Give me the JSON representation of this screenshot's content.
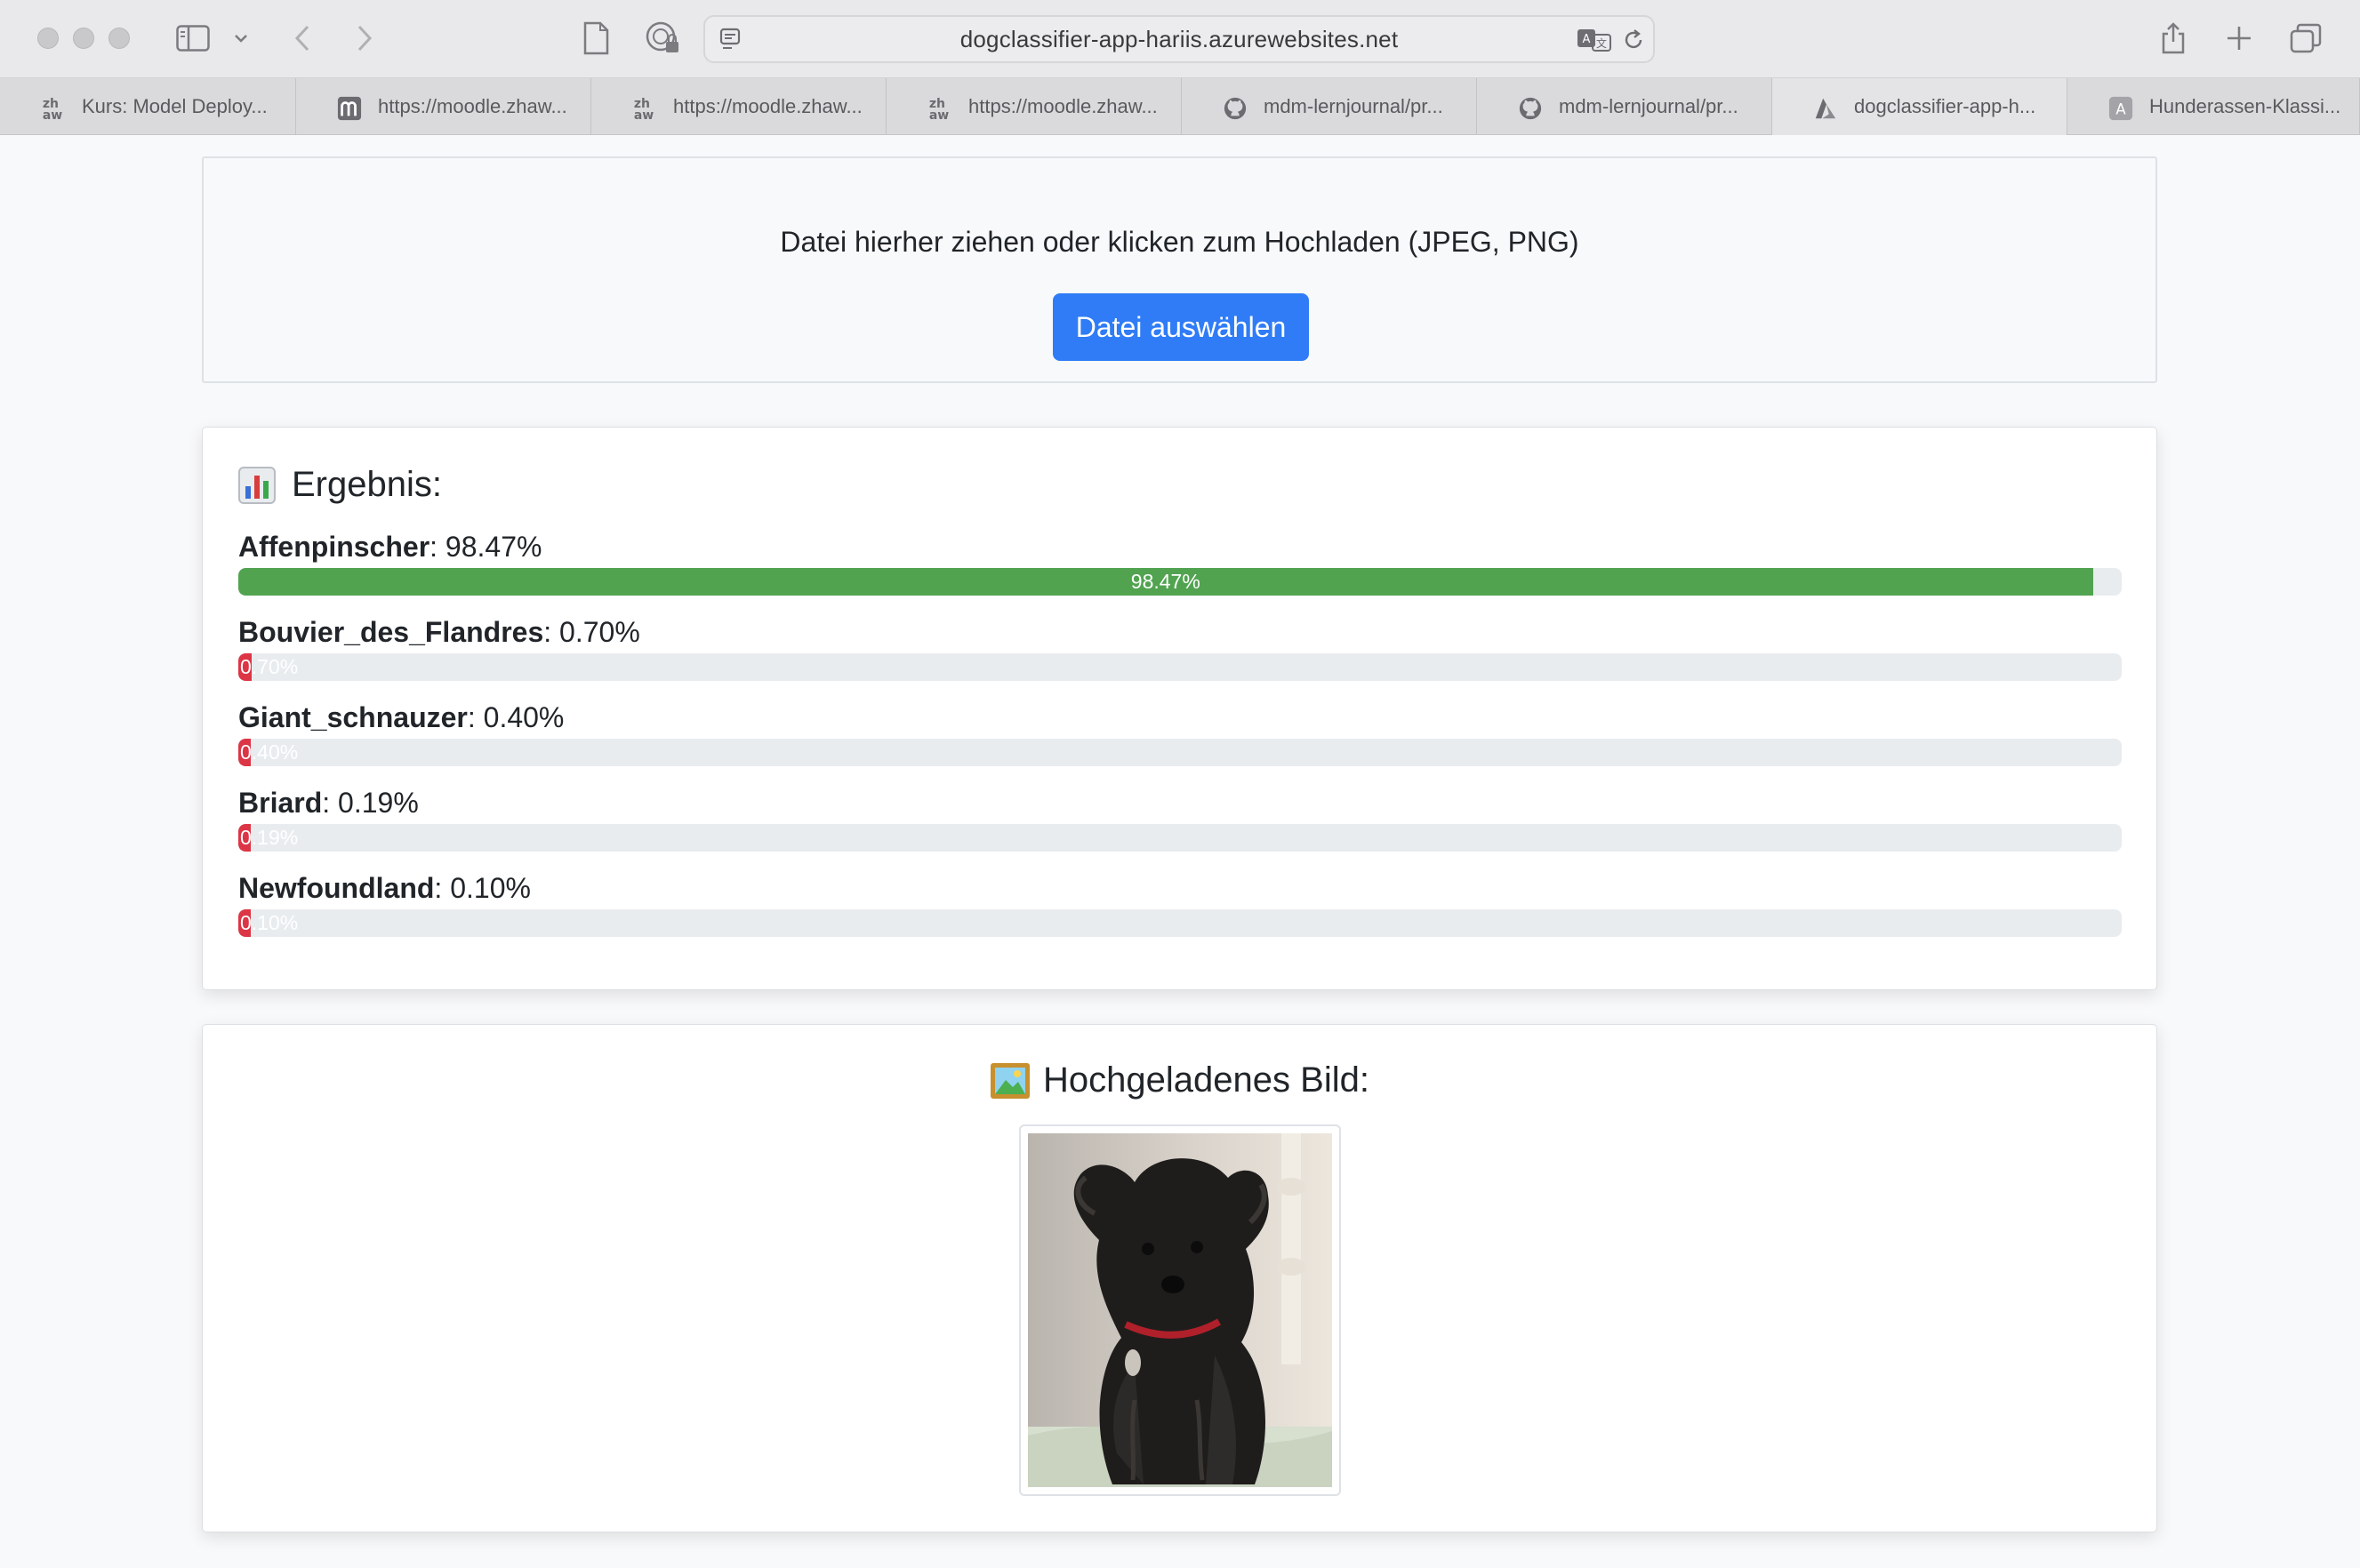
{
  "browser": {
    "url": "dogclassifier-app-hariis.azurewebsites.net",
    "tabs": [
      {
        "label": "Kurs: Model Deploy...",
        "icon": "zhaw-icon"
      },
      {
        "label": "https://moodle.zhaw...",
        "icon": "moodle-icon"
      },
      {
        "label": "https://moodle.zhaw...",
        "icon": "zhaw-icon"
      },
      {
        "label": "https://moodle.zhaw...",
        "icon": "zhaw-icon"
      },
      {
        "label": "mdm-lernjournal/pr...",
        "icon": "github-icon"
      },
      {
        "label": "mdm-lernjournal/pr...",
        "icon": "github-icon"
      },
      {
        "label": "dogclassifier-app-h...",
        "icon": "azure-icon"
      },
      {
        "label": "Hunderassen-Klassi...",
        "icon": "a-icon"
      }
    ]
  },
  "upload": {
    "hint": "Datei hierher ziehen oder klicken zum Hochladen (JPEG, PNG)",
    "button_label": "Datei auswählen"
  },
  "result": {
    "heading": "Ergebnis:",
    "predictions": [
      {
        "breed": "Affenpinscher",
        "percent_text": "98.47%",
        "value": 98.47,
        "color": "#51a350"
      },
      {
        "breed": "Bouvier_des_Flandres",
        "percent_text": "0.70%",
        "value": 0.7,
        "color": "#dc3545"
      },
      {
        "breed": "Giant_schnauzer",
        "percent_text": "0.40%",
        "value": 0.4,
        "color": "#dc3545"
      },
      {
        "breed": "Briard",
        "percent_text": "0.19%",
        "value": 0.19,
        "color": "#dc3545"
      },
      {
        "breed": "Newfoundland",
        "percent_text": "0.10%",
        "value": 0.1,
        "color": "#dc3545"
      }
    ]
  },
  "uploaded": {
    "heading": "Hochgeladenes Bild:"
  },
  "colors": {
    "primary_button": "#2f7cf6",
    "success_bar": "#51a350",
    "danger_bar": "#dc3545",
    "track": "#e9ecef"
  }
}
